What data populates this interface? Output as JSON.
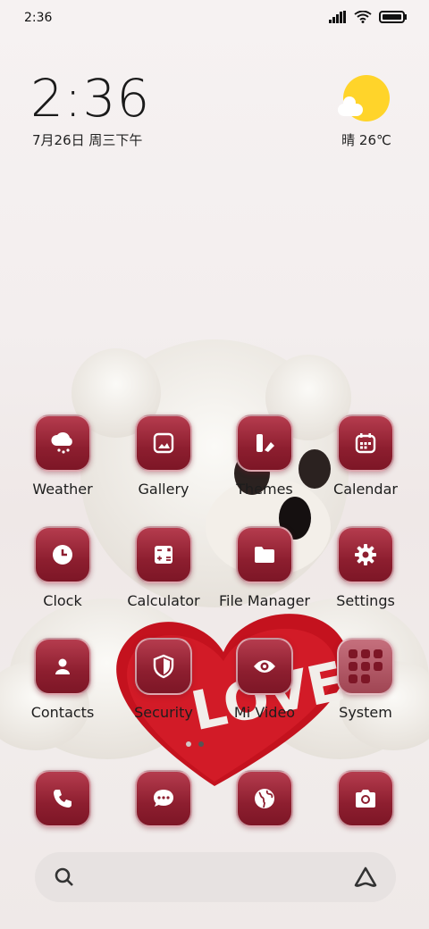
{
  "status_bar": {
    "time": "2:36"
  },
  "clock": {
    "time": "2:36",
    "date": "7月26日 周三下午"
  },
  "weather_widget": {
    "text": "晴 26℃"
  },
  "apps": [
    {
      "label": "Weather",
      "icon": "cloud-snow-icon"
    },
    {
      "label": "Gallery",
      "icon": "image-icon"
    },
    {
      "label": "Themes",
      "icon": "themes-icon"
    },
    {
      "label": "Calendar",
      "icon": "calendar-icon"
    },
    {
      "label": "Clock",
      "icon": "clock-icon"
    },
    {
      "label": "Calculator",
      "icon": "calculator-icon"
    },
    {
      "label": "File Manager",
      "icon": "folder-icon"
    },
    {
      "label": "Settings",
      "icon": "gear-icon"
    },
    {
      "label": "Contacts",
      "icon": "person-icon"
    },
    {
      "label": "Security",
      "icon": "shield-icon"
    },
    {
      "label": "Mi Video",
      "icon": "eye-icon"
    },
    {
      "label": "System",
      "icon": "folder-grid-icon"
    }
  ],
  "dock": [
    {
      "icon": "phone-icon"
    },
    {
      "icon": "message-icon"
    },
    {
      "icon": "globe-icon"
    },
    {
      "icon": "camera-icon"
    }
  ],
  "page_indicator": {
    "pages": 2,
    "active": 2
  },
  "colors": {
    "icon_top": "#b53c4e",
    "icon_bottom": "#7d1626",
    "sun": "#ffd42a"
  }
}
